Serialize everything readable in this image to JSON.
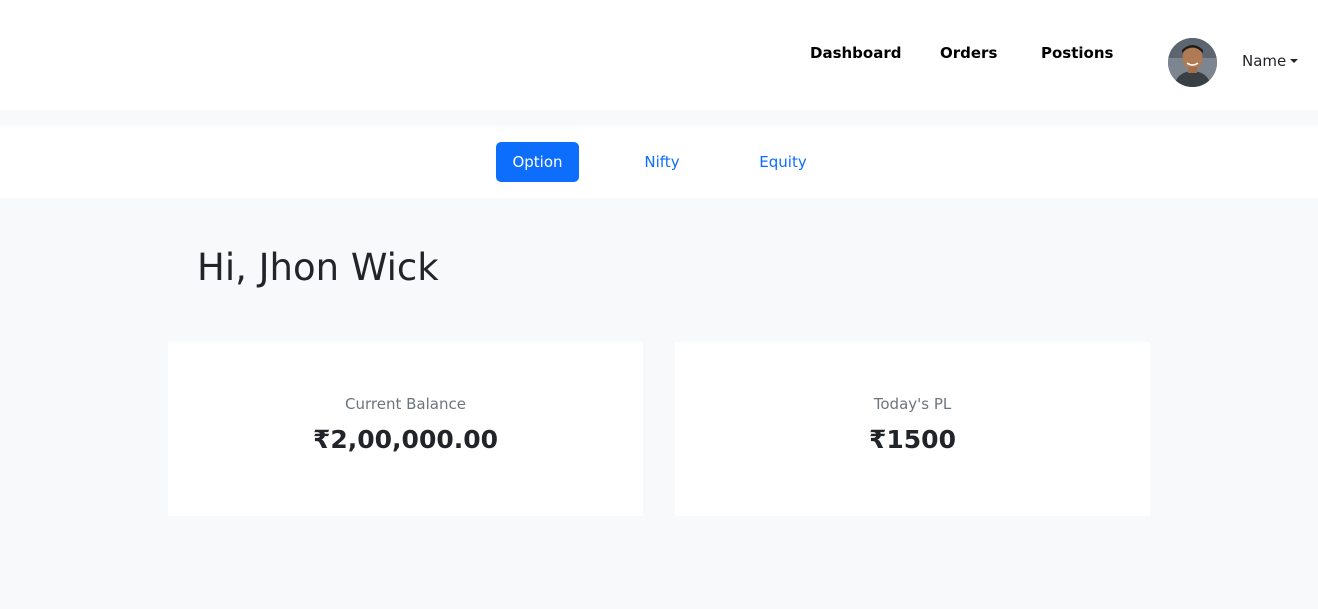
{
  "nav": {
    "links": [
      "Dashboard",
      "Orders",
      "Postions"
    ],
    "user_name": "Name",
    "avatar_icon": "user-avatar"
  },
  "tabs": [
    {
      "label": "Option",
      "active": true
    },
    {
      "label": "Nifty",
      "active": false
    },
    {
      "label": "Equity",
      "active": false
    }
  ],
  "greeting": "Hi, Jhon Wick",
  "cards": [
    {
      "label": "Current Balance",
      "value": "₹2,00,000.00"
    },
    {
      "label": "Today's PL",
      "value": "₹1500"
    }
  ],
  "colors": {
    "accent": "#0d6efd",
    "page_background": "#f8f9fa",
    "muted_text": "#6c757d"
  }
}
